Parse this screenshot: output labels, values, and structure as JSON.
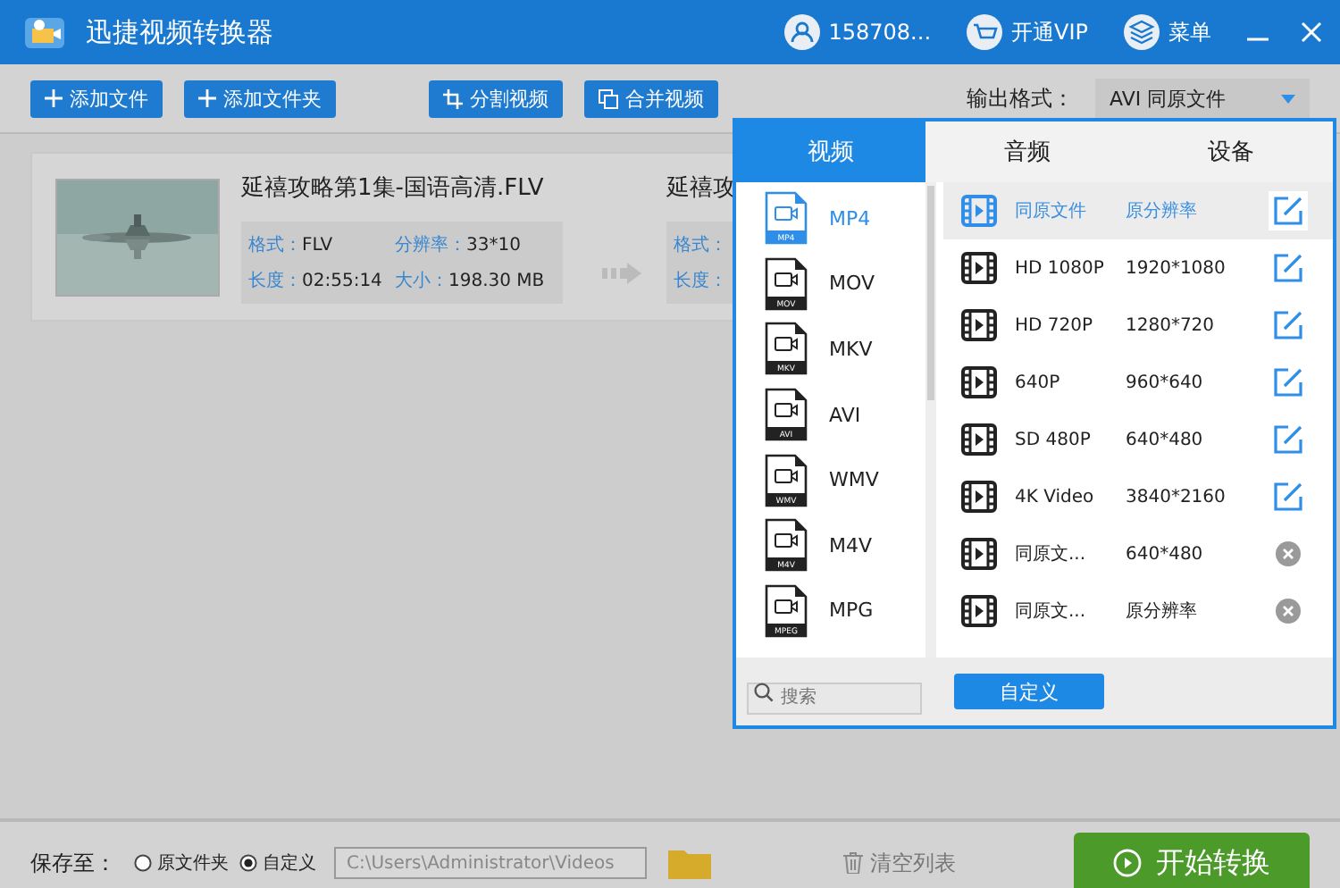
{
  "window": {
    "title": "迅捷视频转换器",
    "user": "158708...",
    "vip": "开通VIP",
    "menu": "菜单"
  },
  "toolbar": {
    "buttons": [
      {
        "label": "添加文件",
        "kind": "add"
      },
      {
        "label": "添加文件夹",
        "kind": "add"
      },
      {
        "label": "分割视频",
        "kind": "split"
      },
      {
        "label": "合并视频",
        "kind": "merge"
      }
    ],
    "output_label": "输出格式：",
    "output_value": "AVI  同原文件"
  },
  "files": [
    {
      "title": "延禧攻略第1集-国语高清.FLV",
      "format_label": "格式：",
      "format": "FLV",
      "resolution_label": "分辨率：",
      "resolution": "33*10",
      "duration_label": "长度：",
      "duration": "02:55:14",
      "size_label": "大小：",
      "size": "198.30 MB",
      "target_title": "延禧攻",
      "target_format_label": "格式：",
      "target_duration_label": "长度："
    }
  ],
  "format_popup": {
    "tabs": [
      {
        "label": "视频",
        "selected": true
      },
      {
        "label": "音频",
        "selected": false
      },
      {
        "label": "设备",
        "selected": false
      }
    ],
    "formats": [
      {
        "name": "MP4",
        "tag": "MP4",
        "selected": true
      },
      {
        "name": "MOV",
        "tag": "MOV",
        "selected": false
      },
      {
        "name": "MKV",
        "tag": "MKV",
        "selected": false
      },
      {
        "name": "AVI",
        "tag": "AVI",
        "selected": false
      },
      {
        "name": "WMV",
        "tag": "WMV",
        "selected": false
      },
      {
        "name": "M4V",
        "tag": "M4V",
        "selected": false
      },
      {
        "name": "MPG",
        "tag": "MPEG",
        "selected": false
      }
    ],
    "presets": [
      {
        "name": "同原文件",
        "resolution": "原分辨率",
        "kind": "edit",
        "selected": true
      },
      {
        "name": "HD 1080P",
        "resolution": "1920*1080",
        "kind": "edit",
        "selected": false
      },
      {
        "name": "HD 720P",
        "resolution": "1280*720",
        "kind": "edit",
        "selected": false
      },
      {
        "name": "640P",
        "resolution": "960*640",
        "kind": "edit",
        "selected": false
      },
      {
        "name": "SD 480P",
        "resolution": "640*480",
        "kind": "edit",
        "selected": false
      },
      {
        "name": "4K Video",
        "resolution": "3840*2160",
        "kind": "edit",
        "selected": false
      },
      {
        "name": "同原文...",
        "resolution": "640*480",
        "kind": "delete",
        "selected": false
      },
      {
        "name": "同原文...",
        "resolution": "原分辨率",
        "kind": "delete",
        "selected": false
      }
    ],
    "search": {
      "placeholder": "搜索"
    },
    "custom_button": "自定义"
  },
  "bottom_bar": {
    "save_label": "保存至：",
    "options": [
      {
        "label": "原文件夹",
        "selected": false
      },
      {
        "label": "自定义",
        "selected": true
      }
    ],
    "path": "C:\\Users\\Administrator\\Videos",
    "clear": "清空列表",
    "start": "开始转换"
  }
}
